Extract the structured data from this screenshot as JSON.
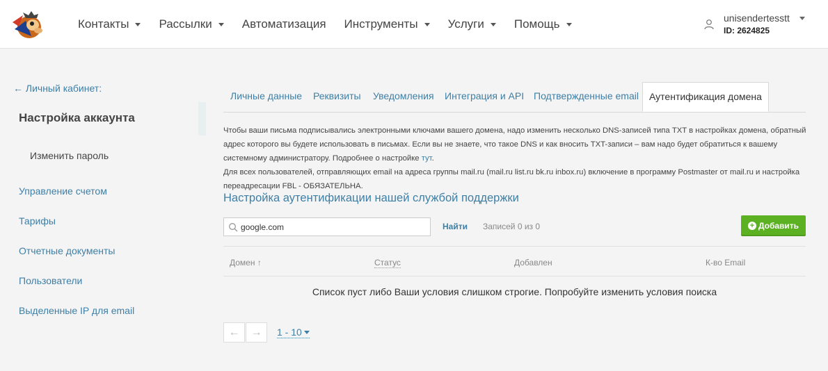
{
  "header": {
    "nav": [
      {
        "label": "Контакты",
        "dropdown": true
      },
      {
        "label": "Рассылки",
        "dropdown": true
      },
      {
        "label": "Автоматизация",
        "dropdown": false
      },
      {
        "label": "Инструменты",
        "dropdown": true
      },
      {
        "label": "Услуги",
        "dropdown": true
      },
      {
        "label": "Помощь",
        "dropdown": true
      }
    ],
    "user": {
      "name": "unisendertesstt",
      "id": "ID: 2624825"
    }
  },
  "sidebar": {
    "back_link": "← Личный кабинет:",
    "title": "Настройка аккаунта",
    "sub_item": "Изменить пароль",
    "items": [
      "Управление счетом",
      "Тарифы",
      "Отчетные документы",
      "Пользователи",
      "Выделенные IP для email"
    ]
  },
  "tabs": [
    {
      "label": "Личные данные",
      "active": false
    },
    {
      "label": "Реквизиты",
      "active": false
    },
    {
      "label": "Уведомления",
      "active": false
    },
    {
      "label": "Интеграция и API",
      "active": false
    },
    {
      "label": "Подтвержденные email",
      "active": false
    },
    {
      "label": "Аутентификация домена",
      "active": true
    }
  ],
  "description": {
    "para1": "Чтобы ваши письма подписывались электронными ключами вашего домена, надо изменить несколько DNS-записей типа TXT в настройках домена, обратный адрес которого вы будете использовать в письмах. Если вы не знаете, что такое DNS и как вносить TXT-записи – вам надо будет обратиться к вашему системному администратору. Подробнее о настройке ",
    "link": "тут",
    "para1_end": ".",
    "para2": " Для всех пользователей, отправляющих email на адреса группы mail.ru (mail.ru list.ru bk.ru inbox.ru) включение в программу Postmaster от mail.ru и настройка переадресации FBL - ОБЯЗАТЕЛЬНА."
  },
  "section_title": "Настройка аутентификации нашей службой поддержки",
  "search": {
    "value": "google.com",
    "placeholder": "google.com",
    "button": "Найти",
    "records": "Записей 0 из 0"
  },
  "add_button": "Добавить",
  "table": {
    "columns": [
      "Домен ↑",
      "Статус",
      "Добавлен",
      "К-во Email"
    ],
    "empty_message": "Список пуст либо Ваши условия слишком строгие. Попробуйте изменить условия поиска"
  },
  "pagination": {
    "prev": "←",
    "next": "→",
    "per_page": "1 - 10"
  },
  "colors": {
    "accent": "#3e7fa6",
    "add_button": "#5bb122",
    "background": "#f4f4f4"
  }
}
